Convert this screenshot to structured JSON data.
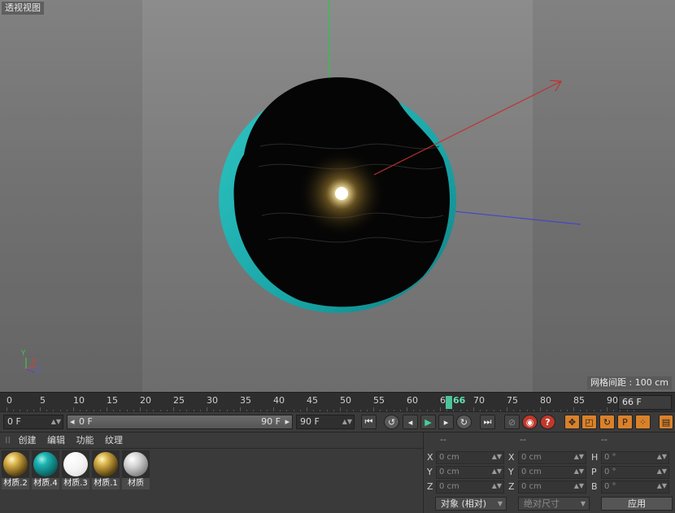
{
  "viewport": {
    "title": "透视视图",
    "grid_spacing": "网格间距 : 100 cm",
    "axis_labels": {
      "y": "Y",
      "x": "X",
      "z": "Z"
    }
  },
  "timeline": {
    "ruler_labels": [
      "0",
      "5",
      "10",
      "15",
      "20",
      "25",
      "30",
      "35",
      "40",
      "45",
      "50",
      "55",
      "60",
      "65",
      "70",
      "75",
      "80",
      "85",
      "90"
    ],
    "current_frame_marker": "66",
    "current_frame": "66 F"
  },
  "transport": {
    "start_frame": "0 F",
    "range_start": "0 F",
    "range_end": "90 F",
    "end_frame": "90 F"
  },
  "materials": {
    "menu": [
      "创建",
      "编辑",
      "功能",
      "纹理"
    ],
    "items": [
      {
        "name": "材质.2",
        "color": "#b8962e"
      },
      {
        "name": "材质.4",
        "color": "#0e8c8c"
      },
      {
        "name": "材质.3",
        "color": "#f2f2f2"
      },
      {
        "name": "材质.1",
        "color": "#b8962e"
      },
      {
        "name": "材质",
        "color": "#bfbfbf"
      }
    ]
  },
  "coordinates": {
    "headers": [
      "--",
      "--",
      "--"
    ],
    "rows": [
      {
        "l1": "X",
        "v1": "0 cm",
        "l2": "X",
        "v2": "0 cm",
        "l3": "H",
        "v3": "0 °"
      },
      {
        "l1": "Y",
        "v1": "0 cm",
        "l2": "Y",
        "v2": "0 cm",
        "l3": "P",
        "v3": "0 °"
      },
      {
        "l1": "Z",
        "v1": "0 cm",
        "l2": "Z",
        "v2": "0 cm",
        "l3": "B",
        "v3": "0 °"
      }
    ],
    "mode_dropdown": "对象 (相对)",
    "size_dropdown": "绝对尺寸",
    "apply_label": "应用"
  }
}
